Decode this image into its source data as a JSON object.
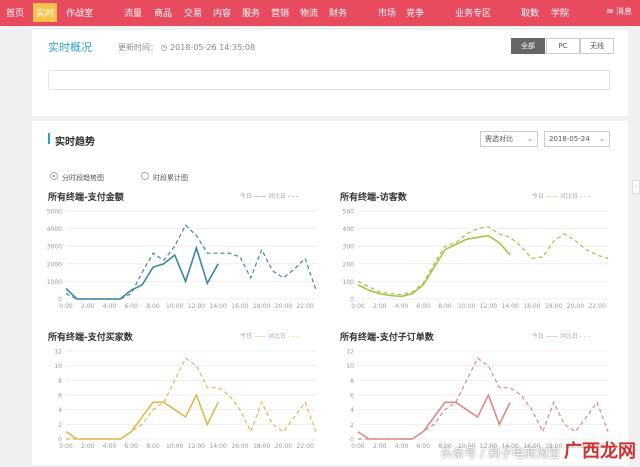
{
  "nav": {
    "items": [
      "首页",
      "实时",
      "作战室",
      "流量",
      "商品",
      "交易",
      "内容",
      "服务",
      "营销",
      "物流",
      "财务",
      "市场",
      "竞争",
      "业务专区",
      "取数",
      "学院"
    ],
    "active_index": 1,
    "message_label": "消息"
  },
  "header": {
    "title": "实时概况",
    "update_label": "更新时间：",
    "update_time": "2018-05-26 14:35:08",
    "segments": [
      "全部",
      "PC",
      "无线"
    ],
    "active_segment": 0
  },
  "trend": {
    "title": "实时趋势",
    "compare_select": "需选对比",
    "date_select": "2018-05-24",
    "radio_options": [
      "分时段趋势图",
      "时段累计图"
    ],
    "active_radio": 0
  },
  "charts": [
    {
      "title": "所有终端-支付金额",
      "legend_today": "今日",
      "legend_compare": "对比日",
      "color": "#3a86a8",
      "chart_data": {
        "type": "line",
        "ylim": [
          0,
          5000
        ],
        "yticks": [
          "5000",
          "4000",
          "3000",
          "2000",
          "1000",
          "0"
        ],
        "xticks": [
          "0:00",
          "2:00",
          "4:00",
          "6:00",
          "8:00",
          "10:00",
          "12:00",
          "14:00",
          "16:00",
          "18:00",
          "20:00",
          "22:00"
        ],
        "series": [
          {
            "name": "今日",
            "x": [
              0,
              1,
              2,
              3,
              4,
              5,
              6,
              7,
              8,
              9,
              10,
              11,
              12,
              13,
              14
            ],
            "values": [
              600,
              0,
              0,
              0,
              0,
              0,
              500,
              800,
              1800,
              2000,
              2500,
              1000,
              2900,
              900,
              2000
            ]
          },
          {
            "name": "对比日",
            "x": [
              0,
              1,
              2,
              3,
              4,
              5,
              6,
              7,
              8,
              9,
              10,
              11,
              12,
              13,
              14,
              15,
              16,
              17,
              18,
              19,
              20,
              21,
              22,
              23
            ],
            "values": [
              300,
              0,
              0,
              0,
              0,
              0,
              300,
              1500,
              2600,
              2200,
              3000,
              4200,
              3600,
              2600,
              2600,
              2600,
              2400,
              1200,
              2800,
              1600,
              1200,
              1700,
              2300,
              500
            ]
          }
        ]
      }
    },
    {
      "title": "所有终端-访客数",
      "legend_today": "今日",
      "legend_compare": "对比日",
      "color": "#a6c445",
      "chart_data": {
        "type": "line",
        "ylim": [
          0,
          500
        ],
        "yticks": [
          "500",
          "400",
          "300",
          "200",
          "100",
          "0"
        ],
        "xticks": [
          "0:00",
          "2:00",
          "4:00",
          "6:00",
          "8:00",
          "10:00",
          "12:00",
          "14:00",
          "16:00",
          "18:00",
          "20:00",
          "22:00"
        ],
        "series": [
          {
            "name": "今日",
            "x": [
              0,
              1,
              2,
              3,
              4,
              5,
              6,
              7,
              8,
              9,
              10,
              11,
              12,
              13,
              14
            ],
            "values": [
              80,
              50,
              30,
              20,
              15,
              30,
              80,
              180,
              280,
              310,
              340,
              350,
              360,
              320,
              250
            ]
          },
          {
            "name": "对比日",
            "x": [
              0,
              1,
              2,
              3,
              4,
              5,
              6,
              7,
              8,
              9,
              10,
              11,
              12,
              13,
              14,
              15,
              16,
              17,
              18,
              19,
              20,
              21,
              22,
              23
            ],
            "values": [
              100,
              70,
              40,
              30,
              25,
              40,
              90,
              200,
              300,
              320,
              370,
              400,
              410,
              370,
              350,
              300,
              230,
              240,
              330,
              370,
              330,
              280,
              250,
              230
            ]
          }
        ]
      }
    },
    {
      "title": "所有终端-支付买家数",
      "legend_today": "今日",
      "legend_compare": "对比日",
      "color": "#e0b84a",
      "chart_data": {
        "type": "line",
        "ylim": [
          0,
          12
        ],
        "yticks": [
          "12",
          "10",
          "8",
          "6",
          "4",
          "2",
          "0"
        ],
        "xticks": [
          "0:00",
          "2:00",
          "4:00",
          "6:00",
          "8:00",
          "10:00",
          "12:00",
          "14:00",
          "16:00",
          "18:00",
          "20:00",
          "22:00"
        ],
        "series": [
          {
            "name": "今日",
            "x": [
              0,
              1,
              2,
              3,
              4,
              5,
              6,
              7,
              8,
              9,
              10,
              11,
              12,
              13,
              14
            ],
            "values": [
              1,
              0,
              0,
              0,
              0,
              0,
              1,
              3,
              5,
              5,
              4,
              3,
              6,
              2,
              5
            ]
          },
          {
            "name": "对比日",
            "x": [
              0,
              1,
              2,
              3,
              4,
              5,
              6,
              7,
              8,
              9,
              10,
              11,
              12,
              13,
              14,
              15,
              16,
              17,
              18,
              19,
              20,
              21,
              22,
              23
            ],
            "values": [
              0,
              0,
              0,
              0,
              0,
              0,
              1,
              2,
              4,
              5,
              8,
              11,
              10,
              7,
              7,
              6,
              4,
              1,
              5,
              2,
              1,
              3,
              5,
              1
            ]
          }
        ]
      }
    },
    {
      "title": "所有终端-支付子订单数",
      "legend_today": "今日",
      "legend_compare": "对比日",
      "color": "#d98a86",
      "chart_data": {
        "type": "line",
        "ylim": [
          0,
          12
        ],
        "yticks": [
          "12",
          "10",
          "8",
          "6",
          "4",
          "2",
          "0"
        ],
        "xticks": [
          "0:00",
          "2:00",
          "4:00",
          "6:00",
          "8:00",
          "10:00",
          "12:00",
          "14:00",
          "16:00",
          "18:00",
          "20:00",
          "22:00"
        ],
        "series": [
          {
            "name": "今日",
            "x": [
              0,
              1,
              2,
              3,
              4,
              5,
              6,
              7,
              8,
              9,
              10,
              11,
              12,
              13,
              14
            ],
            "values": [
              1,
              0,
              0,
              0,
              0,
              0,
              1,
              3,
              5,
              5,
              4,
              3,
              6,
              2,
              5
            ]
          },
          {
            "name": "对比日",
            "x": [
              0,
              1,
              2,
              3,
              4,
              5,
              6,
              7,
              8,
              9,
              10,
              11,
              12,
              13,
              14,
              15,
              16,
              17,
              18,
              19,
              20,
              21,
              22,
              23
            ],
            "values": [
              0,
              0,
              0,
              0,
              0,
              0,
              1,
              2,
              4,
              5,
              8,
              11,
              10,
              7,
              7,
              6,
              4,
              1,
              5,
              2,
              1,
              3,
              5,
              1
            ]
          }
        ]
      }
    }
  ],
  "watermark": {
    "text": "头条号 / 莉子电商淘宝",
    "logo_text": "广西龙网"
  }
}
